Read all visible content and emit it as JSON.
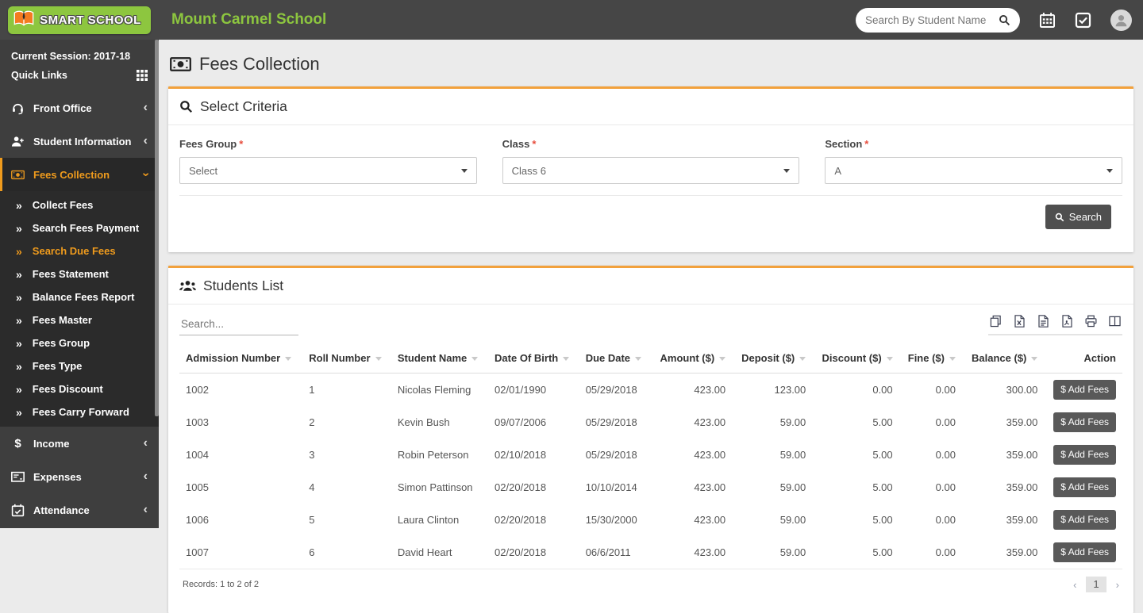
{
  "header": {
    "logo_text": "SMART SCHOOL",
    "school_name": "Mount Carmel School",
    "search_placeholder": "Search By Student Name"
  },
  "sidebar": {
    "session": "Current Session: 2017-18",
    "quick_links": "Quick Links",
    "menu": [
      {
        "label": "Front Office",
        "icon": "headset-icon"
      },
      {
        "label": "Student Information",
        "icon": "user-plus-icon"
      },
      {
        "label": "Fees Collection",
        "icon": "money-icon",
        "active": true
      },
      {
        "label": "Income",
        "icon": "dollar-icon"
      },
      {
        "label": "Expenses",
        "icon": "money-check-icon"
      },
      {
        "label": "Attendance",
        "icon": "calendar-check-icon"
      }
    ],
    "fees_submenu": [
      {
        "label": "Collect Fees"
      },
      {
        "label": "Search Fees Payment"
      },
      {
        "label": "Search Due Fees",
        "active": true
      },
      {
        "label": "Fees Statement"
      },
      {
        "label": "Balance Fees Report"
      },
      {
        "label": "Fees Master"
      },
      {
        "label": "Fees Group"
      },
      {
        "label": "Fees Type"
      },
      {
        "label": "Fees Discount"
      },
      {
        "label": "Fees Carry Forward"
      }
    ]
  },
  "page": {
    "title": "Fees Collection"
  },
  "criteria": {
    "title": "Select Criteria",
    "required_mark": "*",
    "fields": [
      {
        "label": "Fees Group",
        "value": "Select"
      },
      {
        "label": "Class",
        "value": "Class 6"
      },
      {
        "label": "Section",
        "value": "A"
      }
    ],
    "search_button": "Search"
  },
  "students": {
    "title": "Students List",
    "search_placeholder": "Search...",
    "export_tools": [
      "copy",
      "excel",
      "csv",
      "pdf",
      "print",
      "column-visibility"
    ],
    "columns": [
      "Admission Number",
      "Roll Number",
      "Student Name",
      "Date Of Birth",
      "Due Date",
      "Amount ($)",
      "Deposit ($)",
      "Discount ($)",
      "Fine ($)",
      "Balance ($)",
      "Action"
    ],
    "action_label": "$ Add Fees",
    "rows": [
      {
        "admission": "1002",
        "roll": "1",
        "name": "Nicolas Fleming",
        "dob": "02/01/1990",
        "due": "05/29/2018",
        "amount": "423.00",
        "deposit": "123.00",
        "discount": "0.00",
        "fine": "0.00",
        "balance": "300.00"
      },
      {
        "admission": "1003",
        "roll": "2",
        "name": "Kevin Bush",
        "dob": "09/07/2006",
        "due": "05/29/2018",
        "amount": "423.00",
        "deposit": "59.00",
        "discount": "5.00",
        "fine": "0.00",
        "balance": "359.00"
      },
      {
        "admission": "1004",
        "roll": "3",
        "name": "Robin Peterson",
        "dob": "02/10/2018",
        "due": "05/29/2018",
        "amount": "423.00",
        "deposit": "59.00",
        "discount": "5.00",
        "fine": "0.00",
        "balance": "359.00"
      },
      {
        "admission": "1005",
        "roll": "4",
        "name": "Simon Pattinson",
        "dob": "02/20/2018",
        "due": "10/10/2014",
        "amount": "423.00",
        "deposit": "59.00",
        "discount": "5.00",
        "fine": "0.00",
        "balance": "359.00"
      },
      {
        "admission": "1006",
        "roll": "5",
        "name": "Laura Clinton",
        "dob": "02/20/2018",
        "due": "15/30/2000",
        "amount": "423.00",
        "deposit": "59.00",
        "discount": "5.00",
        "fine": "0.00",
        "balance": "359.00"
      },
      {
        "admission": "1007",
        "roll": "6",
        "name": "David Heart",
        "dob": "02/20/2018",
        "due": "06/6/2011",
        "amount": "423.00",
        "deposit": "59.00",
        "discount": "5.00",
        "fine": "0.00",
        "balance": "359.00"
      }
    ],
    "records_text": "Records: 1 to 2 of 2",
    "pagination": {
      "prev": "‹",
      "current": "1",
      "next": "›"
    }
  },
  "colors": {
    "accent_orange": "#F2A13C",
    "active_orange": "#EF9B1D",
    "brand_green": "#8DC63F",
    "header_bg": "#464646",
    "sidebar_bg": "#3E3E3E",
    "submenu_bg": "#2B2B2B",
    "button_dark": "#4F4F4F",
    "required_red": "#E74C3C"
  }
}
